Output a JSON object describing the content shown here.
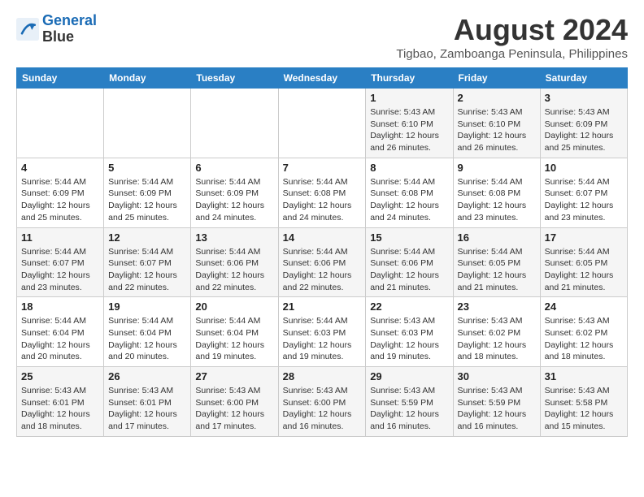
{
  "header": {
    "logo_line1": "General",
    "logo_line2": "Blue",
    "main_title": "August 2024",
    "subtitle": "Tigbao, Zamboanga Peninsula, Philippines"
  },
  "calendar": {
    "days_of_week": [
      "Sunday",
      "Monday",
      "Tuesday",
      "Wednesday",
      "Thursday",
      "Friday",
      "Saturday"
    ],
    "weeks": [
      [
        {
          "day": "",
          "info": ""
        },
        {
          "day": "",
          "info": ""
        },
        {
          "day": "",
          "info": ""
        },
        {
          "day": "",
          "info": ""
        },
        {
          "day": "1",
          "info": "Sunrise: 5:43 AM\nSunset: 6:10 PM\nDaylight: 12 hours\nand 26 minutes."
        },
        {
          "day": "2",
          "info": "Sunrise: 5:43 AM\nSunset: 6:10 PM\nDaylight: 12 hours\nand 26 minutes."
        },
        {
          "day": "3",
          "info": "Sunrise: 5:43 AM\nSunset: 6:09 PM\nDaylight: 12 hours\nand 25 minutes."
        }
      ],
      [
        {
          "day": "4",
          "info": "Sunrise: 5:44 AM\nSunset: 6:09 PM\nDaylight: 12 hours\nand 25 minutes."
        },
        {
          "day": "5",
          "info": "Sunrise: 5:44 AM\nSunset: 6:09 PM\nDaylight: 12 hours\nand 25 minutes."
        },
        {
          "day": "6",
          "info": "Sunrise: 5:44 AM\nSunset: 6:09 PM\nDaylight: 12 hours\nand 24 minutes."
        },
        {
          "day": "7",
          "info": "Sunrise: 5:44 AM\nSunset: 6:08 PM\nDaylight: 12 hours\nand 24 minutes."
        },
        {
          "day": "8",
          "info": "Sunrise: 5:44 AM\nSunset: 6:08 PM\nDaylight: 12 hours\nand 24 minutes."
        },
        {
          "day": "9",
          "info": "Sunrise: 5:44 AM\nSunset: 6:08 PM\nDaylight: 12 hours\nand 23 minutes."
        },
        {
          "day": "10",
          "info": "Sunrise: 5:44 AM\nSunset: 6:07 PM\nDaylight: 12 hours\nand 23 minutes."
        }
      ],
      [
        {
          "day": "11",
          "info": "Sunrise: 5:44 AM\nSunset: 6:07 PM\nDaylight: 12 hours\nand 23 minutes."
        },
        {
          "day": "12",
          "info": "Sunrise: 5:44 AM\nSunset: 6:07 PM\nDaylight: 12 hours\nand 22 minutes."
        },
        {
          "day": "13",
          "info": "Sunrise: 5:44 AM\nSunset: 6:06 PM\nDaylight: 12 hours\nand 22 minutes."
        },
        {
          "day": "14",
          "info": "Sunrise: 5:44 AM\nSunset: 6:06 PM\nDaylight: 12 hours\nand 22 minutes."
        },
        {
          "day": "15",
          "info": "Sunrise: 5:44 AM\nSunset: 6:06 PM\nDaylight: 12 hours\nand 21 minutes."
        },
        {
          "day": "16",
          "info": "Sunrise: 5:44 AM\nSunset: 6:05 PM\nDaylight: 12 hours\nand 21 minutes."
        },
        {
          "day": "17",
          "info": "Sunrise: 5:44 AM\nSunset: 6:05 PM\nDaylight: 12 hours\nand 21 minutes."
        }
      ],
      [
        {
          "day": "18",
          "info": "Sunrise: 5:44 AM\nSunset: 6:04 PM\nDaylight: 12 hours\nand 20 minutes."
        },
        {
          "day": "19",
          "info": "Sunrise: 5:44 AM\nSunset: 6:04 PM\nDaylight: 12 hours\nand 20 minutes."
        },
        {
          "day": "20",
          "info": "Sunrise: 5:44 AM\nSunset: 6:04 PM\nDaylight: 12 hours\nand 19 minutes."
        },
        {
          "day": "21",
          "info": "Sunrise: 5:44 AM\nSunset: 6:03 PM\nDaylight: 12 hours\nand 19 minutes."
        },
        {
          "day": "22",
          "info": "Sunrise: 5:43 AM\nSunset: 6:03 PM\nDaylight: 12 hours\nand 19 minutes."
        },
        {
          "day": "23",
          "info": "Sunrise: 5:43 AM\nSunset: 6:02 PM\nDaylight: 12 hours\nand 18 minutes."
        },
        {
          "day": "24",
          "info": "Sunrise: 5:43 AM\nSunset: 6:02 PM\nDaylight: 12 hours\nand 18 minutes."
        }
      ],
      [
        {
          "day": "25",
          "info": "Sunrise: 5:43 AM\nSunset: 6:01 PM\nDaylight: 12 hours\nand 18 minutes."
        },
        {
          "day": "26",
          "info": "Sunrise: 5:43 AM\nSunset: 6:01 PM\nDaylight: 12 hours\nand 17 minutes."
        },
        {
          "day": "27",
          "info": "Sunrise: 5:43 AM\nSunset: 6:00 PM\nDaylight: 12 hours\nand 17 minutes."
        },
        {
          "day": "28",
          "info": "Sunrise: 5:43 AM\nSunset: 6:00 PM\nDaylight: 12 hours\nand 16 minutes."
        },
        {
          "day": "29",
          "info": "Sunrise: 5:43 AM\nSunset: 5:59 PM\nDaylight: 12 hours\nand 16 minutes."
        },
        {
          "day": "30",
          "info": "Sunrise: 5:43 AM\nSunset: 5:59 PM\nDaylight: 12 hours\nand 16 minutes."
        },
        {
          "day": "31",
          "info": "Sunrise: 5:43 AM\nSunset: 5:58 PM\nDaylight: 12 hours\nand 15 minutes."
        }
      ]
    ]
  }
}
